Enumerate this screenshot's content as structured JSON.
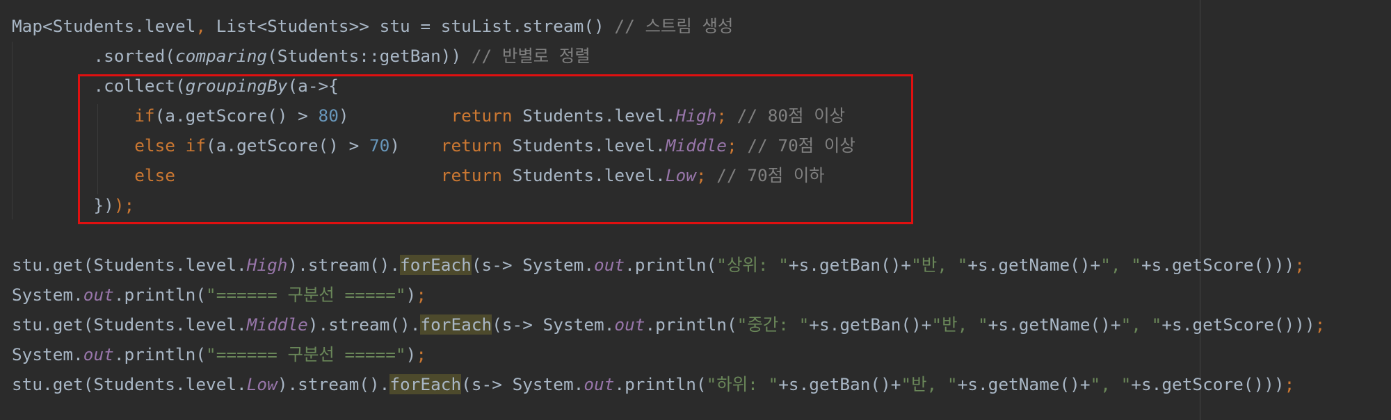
{
  "editor": {
    "theme_colors": {
      "background": "#2b2b2b",
      "keyword": "#cc7832",
      "number": "#6897bb",
      "string": "#6a8759",
      "comment": "#808080",
      "field": "#9876aa",
      "text": "#a9b7c6",
      "highlight_box": "#e01010"
    },
    "lines": [
      {
        "tokens": [
          {
            "t": "Map<Students.level",
            "s": "plain"
          },
          {
            "t": ", ",
            "s": "kw"
          },
          {
            "t": "List<Students>> stu = stuList.stream() ",
            "s": "plain"
          },
          {
            "t": "// 스트림 생성",
            "s": "comment"
          }
        ]
      },
      {
        "tokens": [
          {
            "t": "        .sorted(",
            "s": "plain"
          },
          {
            "t": "comparing",
            "s": "italic"
          },
          {
            "t": "(Students::getBan)) ",
            "s": "plain"
          },
          {
            "t": "// 반별로 정렬",
            "s": "comment"
          }
        ]
      },
      {
        "tokens": [
          {
            "t": "        .collect(",
            "s": "plain"
          },
          {
            "t": "groupingBy",
            "s": "italic"
          },
          {
            "t": "(a->{",
            "s": "plain"
          }
        ]
      },
      {
        "tokens": [
          {
            "t": "            ",
            "s": "plain"
          },
          {
            "t": "if",
            "s": "kw"
          },
          {
            "t": "(a.getScore() > ",
            "s": "plain"
          },
          {
            "t": "80",
            "s": "num"
          },
          {
            "t": ")          ",
            "s": "plain"
          },
          {
            "t": "return ",
            "s": "kw"
          },
          {
            "t": "Students.level.",
            "s": "plain"
          },
          {
            "t": "High",
            "s": "field"
          },
          {
            "t": "; ",
            "s": "kw"
          },
          {
            "t": "// 80점 이상",
            "s": "comment"
          }
        ]
      },
      {
        "tokens": [
          {
            "t": "            ",
            "s": "plain"
          },
          {
            "t": "else if",
            "s": "kw"
          },
          {
            "t": "(a.getScore() > ",
            "s": "plain"
          },
          {
            "t": "70",
            "s": "num"
          },
          {
            "t": ")    ",
            "s": "plain"
          },
          {
            "t": "return ",
            "s": "kw"
          },
          {
            "t": "Students.level.",
            "s": "plain"
          },
          {
            "t": "Middle",
            "s": "field"
          },
          {
            "t": "; ",
            "s": "kw"
          },
          {
            "t": "// 70점 이상",
            "s": "comment"
          }
        ]
      },
      {
        "tokens": [
          {
            "t": "            ",
            "s": "plain"
          },
          {
            "t": "else                          ",
            "s": "kw"
          },
          {
            "t": "return ",
            "s": "kw"
          },
          {
            "t": "Students.level.",
            "s": "plain"
          },
          {
            "t": "Low",
            "s": "field"
          },
          {
            "t": "; ",
            "s": "kw"
          },
          {
            "t": "// 70점 이하",
            "s": "comment"
          }
        ]
      },
      {
        "tokens": [
          {
            "t": "        })",
            "s": "plain"
          },
          {
            "t": ");",
            "s": "kw"
          }
        ]
      },
      {
        "tokens": []
      },
      {
        "tokens": [
          {
            "t": "stu.get(Students.level.",
            "s": "plain"
          },
          {
            "t": "High",
            "s": "field"
          },
          {
            "t": ").stream().",
            "s": "plain"
          },
          {
            "t": "forEach",
            "s": "hl"
          },
          {
            "t": "(s-> System.",
            "s": "plain"
          },
          {
            "t": "out",
            "s": "field"
          },
          {
            "t": ".println(",
            "s": "plain"
          },
          {
            "t": "\"상위: \"",
            "s": "str"
          },
          {
            "t": "+s.getBan()+",
            "s": "plain"
          },
          {
            "t": "\"반, \"",
            "s": "str"
          },
          {
            "t": "+s.getName()+",
            "s": "plain"
          },
          {
            "t": "\", \"",
            "s": "str"
          },
          {
            "t": "+s.getScore()))",
            "s": "plain"
          },
          {
            "t": ";",
            "s": "kw"
          }
        ]
      },
      {
        "tokens": [
          {
            "t": "System.",
            "s": "plain"
          },
          {
            "t": "out",
            "s": "field"
          },
          {
            "t": ".println(",
            "s": "plain"
          },
          {
            "t": "\"====== 구분선 =====\"",
            "s": "str"
          },
          {
            "t": ")",
            "s": "plain"
          },
          {
            "t": ";",
            "s": "kw"
          }
        ]
      },
      {
        "tokens": [
          {
            "t": "stu.get(Students.level.",
            "s": "plain"
          },
          {
            "t": "Middle",
            "s": "field"
          },
          {
            "t": ").stream().",
            "s": "plain"
          },
          {
            "t": "forEach",
            "s": "hl"
          },
          {
            "t": "(s-> System.",
            "s": "plain"
          },
          {
            "t": "out",
            "s": "field"
          },
          {
            "t": ".println(",
            "s": "plain"
          },
          {
            "t": "\"중간: \"",
            "s": "str"
          },
          {
            "t": "+s.getBan()+",
            "s": "plain"
          },
          {
            "t": "\"반, \"",
            "s": "str"
          },
          {
            "t": "+s.getName()+",
            "s": "plain"
          },
          {
            "t": "\", \"",
            "s": "str"
          },
          {
            "t": "+s.getScore()))",
            "s": "plain"
          },
          {
            "t": ";",
            "s": "kw"
          }
        ]
      },
      {
        "tokens": [
          {
            "t": "System.",
            "s": "plain"
          },
          {
            "t": "out",
            "s": "field"
          },
          {
            "t": ".println(",
            "s": "plain"
          },
          {
            "t": "\"====== 구분선 =====\"",
            "s": "str"
          },
          {
            "t": ")",
            "s": "plain"
          },
          {
            "t": ";",
            "s": "kw"
          }
        ]
      },
      {
        "tokens": [
          {
            "t": "stu.get(Students.level.",
            "s": "plain"
          },
          {
            "t": "Low",
            "s": "field"
          },
          {
            "t": ").stream().",
            "s": "plain"
          },
          {
            "t": "forEach",
            "s": "hl"
          },
          {
            "t": "(s-> System.",
            "s": "plain"
          },
          {
            "t": "out",
            "s": "field"
          },
          {
            "t": ".println(",
            "s": "plain"
          },
          {
            "t": "\"하위: \"",
            "s": "str"
          },
          {
            "t": "+s.getBan()+",
            "s": "plain"
          },
          {
            "t": "\"반, \"",
            "s": "str"
          },
          {
            "t": "+s.getName()+",
            "s": "plain"
          },
          {
            "t": "\", \"",
            "s": "str"
          },
          {
            "t": "+s.getScore()))",
            "s": "plain"
          },
          {
            "t": ";",
            "s": "kw"
          }
        ]
      }
    ]
  }
}
